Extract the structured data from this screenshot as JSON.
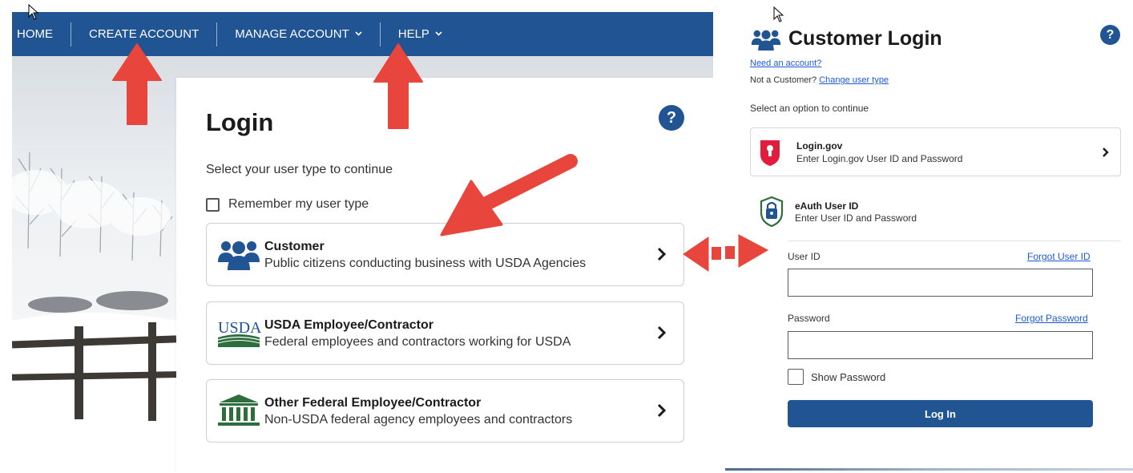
{
  "nav": {
    "items": [
      {
        "label": "HOME",
        "has_dropdown": false
      },
      {
        "label": "CREATE ACCOUNT",
        "has_dropdown": false
      },
      {
        "label": "MANAGE ACCOUNT",
        "has_dropdown": true
      },
      {
        "label": "HELP",
        "has_dropdown": true
      }
    ],
    "chevron": "⌄"
  },
  "login": {
    "title": "Login",
    "help_glyph": "?",
    "subtitle": "Select your user type to continue",
    "remember_label": "Remember my user type",
    "user_types": [
      {
        "title": "Customer",
        "description": "Public citizens conducting business with USDA Agencies",
        "icon": "people-group-icon"
      },
      {
        "title": "USDA Employee/Contractor",
        "description": "Federal employees and contractors working for USDA",
        "icon": "usda-logo-icon",
        "icon_text": "USDA"
      },
      {
        "title": "Other Federal Employee/Contractor",
        "description": "Non-USDA federal agency employees and contractors",
        "icon": "federal-building-icon"
      }
    ]
  },
  "customer_login": {
    "title": "Customer Login",
    "help_glyph": "?",
    "need_account": "Need an account?",
    "not_customer_prefix": "Not a Customer?",
    "change_user_type": "Change user type",
    "select_option": "Select an option to continue",
    "logingov": {
      "title": "Login.gov",
      "description": "Enter Login.gov User ID and Password"
    },
    "eauth": {
      "title": "eAuth User ID",
      "description": "Enter User ID and Password"
    },
    "user_id": {
      "label": "User ID",
      "forgot": "Forgot User ID",
      "value": ""
    },
    "password": {
      "label": "Password",
      "forgot": "Forgot Password",
      "value": ""
    },
    "show_password": "Show Password",
    "login_button": "Log In"
  },
  "colors": {
    "nav_blue": "#205493",
    "link_blue": "#1f5bd8",
    "annotation_red": "#e8453c",
    "logingov_red": "#e21c3d",
    "usda_green": "#2e6d3c"
  }
}
